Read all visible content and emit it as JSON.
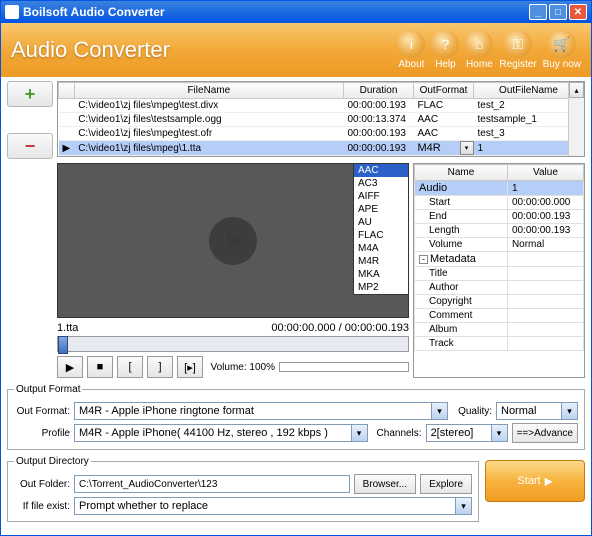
{
  "window": {
    "title": "Boilsoft Audio Converter"
  },
  "header": {
    "title": "Audio Converter",
    "buttons": [
      {
        "icon": "i",
        "label": "About"
      },
      {
        "icon": "?",
        "label": "Help"
      },
      {
        "icon": "⌂",
        "label": "Home"
      },
      {
        "icon": "⚿",
        "label": "Register"
      },
      {
        "icon": "🛒",
        "label": "Buy now"
      }
    ]
  },
  "table": {
    "headers": {
      "filename": "FileName",
      "duration": "Duration",
      "outformat": "OutFormat",
      "outfilename": "OutFileName"
    },
    "rows": [
      {
        "filename": "C:\\video1\\zj files\\mpeg\\test.divx",
        "duration": "00:00:00.193",
        "outformat": "FLAC",
        "outfilename": "test_2"
      },
      {
        "filename": "C:\\video1\\zj files\\testsample.ogg",
        "duration": "00:00:13.374",
        "outformat": "AAC",
        "outfilename": "testsample_1"
      },
      {
        "filename": "C:\\video1\\zj files\\mpeg\\test.ofr",
        "duration": "00:00:00.193",
        "outformat": "AAC",
        "outfilename": "test_3"
      },
      {
        "filename": "C:\\video1\\zj files\\mpeg\\1.tta",
        "duration": "00:00:00.193",
        "outformat": "M4R",
        "outfilename": "1"
      }
    ],
    "selected_marker": "▶"
  },
  "format_dropdown": [
    "AAC",
    "AC3",
    "AIFF",
    "APE",
    "AU",
    "FLAC",
    "M4A",
    "M4R",
    "MKA",
    "MP2"
  ],
  "preview": {
    "filename": "1.tta",
    "time": "00:00:00.000 / 00:00:00.193",
    "volume_label": "Volume: 100%"
  },
  "transport": {
    "play": "▶",
    "stop": "■",
    "mark_in": "[",
    "mark_out": "]",
    "mark_range": "[▸]"
  },
  "properties": {
    "headers": {
      "name": "Name",
      "value": "Value"
    },
    "audio_label": "Audio",
    "audio_value": "1",
    "rows": [
      {
        "k": "Start",
        "v": "00:00:00.000"
      },
      {
        "k": "End",
        "v": "00:00:00.193"
      },
      {
        "k": "Length",
        "v": "00:00:00.193"
      },
      {
        "k": "Volume",
        "v": "Normal"
      }
    ],
    "metadata_label": "Metadata",
    "meta_rows": [
      "Title",
      "Author",
      "Copyright",
      "Comment",
      "Album",
      "Track"
    ]
  },
  "output_format": {
    "legend": "Output Format",
    "out_format_label": "Out Format:",
    "out_format": "M4R - Apple iPhone ringtone format",
    "profile_label": "Profile",
    "profile": "M4R - Apple iPhone( 44100 Hz, stereo , 192 kbps )",
    "quality_label": "Quality:",
    "quality": "Normal",
    "channels_label": "Channels:",
    "channels": "2[stereo]",
    "advance_label": "==>Advance"
  },
  "output_dir": {
    "legend": "Output Directory",
    "folder_label": "Out Folder:",
    "folder": "C:\\Torrent_AudioConverter\\123",
    "browser_label": "Browser...",
    "explore_label": "Explore",
    "exist_label": "If file exist:",
    "exist": "Prompt whether to replace"
  },
  "start_label": "Start"
}
